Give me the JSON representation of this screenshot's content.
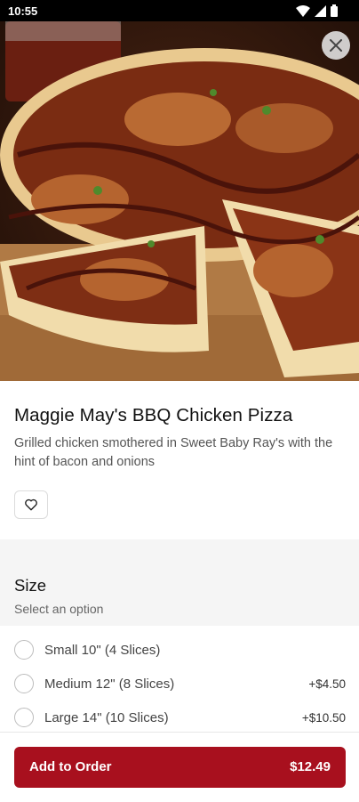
{
  "status_bar": {
    "time": "10:55"
  },
  "icons": {
    "close": "close-icon",
    "favorite": "heart-icon",
    "wifi": "wifi-icon",
    "signal": "signal-icon",
    "battery": "battery-icon"
  },
  "item": {
    "title": "Maggie May's BBQ Chicken Pizza",
    "description": "Grilled chicken smothered in Sweet Baby Ray's with the hint of bacon and onions"
  },
  "size_section": {
    "title": "Size",
    "subtitle": "Select an option",
    "options": [
      {
        "label": "Small 10\" (4 Slices)",
        "price": ""
      },
      {
        "label": "Medium 12\" (8 Slices)",
        "price": "+$4.50"
      },
      {
        "label": "Large 14\" (10 Slices)",
        "price": "+$10.50"
      }
    ]
  },
  "footer": {
    "add_label": "Add to Order",
    "total": "$12.49"
  },
  "colors": {
    "accent": "#a8101e",
    "section_bg": "#f5f5f5"
  }
}
